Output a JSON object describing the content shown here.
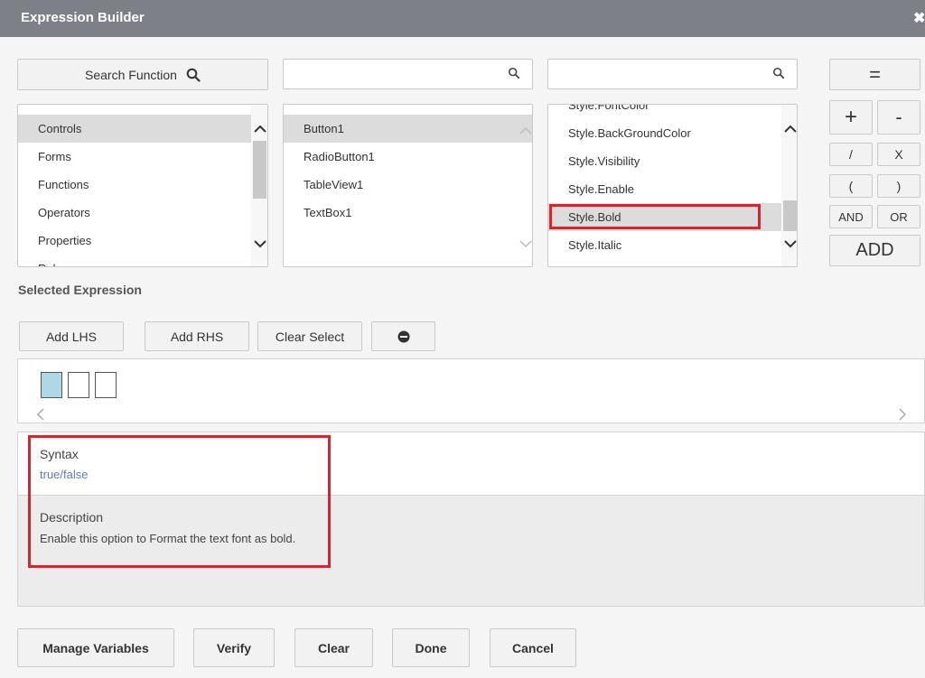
{
  "window": {
    "title": "Expression Builder",
    "close_glyph": "✖"
  },
  "search_function": {
    "label": "Search Function"
  },
  "search_inputs": [
    {
      "value": "",
      "placeholder": ""
    },
    {
      "value": "",
      "placeholder": ""
    }
  ],
  "lists": {
    "categories": {
      "items": [
        "Controls",
        "Forms",
        "Functions",
        "Operators",
        "Properties",
        "Rules"
      ],
      "selected": "Controls"
    },
    "controls": {
      "items": [
        "Button1",
        "RadioButton1",
        "TableView1",
        "TextBox1"
      ],
      "selected": "Button1"
    },
    "properties": {
      "items": [
        "Style.FontColor",
        "Style.BackGroundColor",
        "Style.Visibility",
        "Style.Enable",
        "Style.Bold",
        "Style.Italic"
      ],
      "selected": "Style.Bold"
    }
  },
  "operators": {
    "equals": "=",
    "plus": "+",
    "minus": "-",
    "divide": "/",
    "multiply": "X",
    "open_paren": "(",
    "close_paren": ")",
    "and": "AND",
    "or": "OR",
    "add": "ADD"
  },
  "selected_expression": {
    "label": "Selected Expression",
    "add_lhs": "Add LHS",
    "add_rhs": "Add RHS",
    "clear_select": "Clear Select"
  },
  "info": {
    "syntax_label": "Syntax",
    "syntax_value": "true/false",
    "description_label": "Description",
    "description_value": "Enable this option to Format the text font as bold."
  },
  "footer": {
    "manage_variables": "Manage Variables",
    "verify": "Verify",
    "clear": "Clear",
    "done": "Done",
    "cancel": "Cancel"
  },
  "colors": {
    "titlebar": "#7d8087",
    "highlight_box": "#e0202a",
    "selected_row": "#dcdcdc",
    "syntax_link": "#5b7fb5",
    "slot_filled": "#add8e6"
  }
}
